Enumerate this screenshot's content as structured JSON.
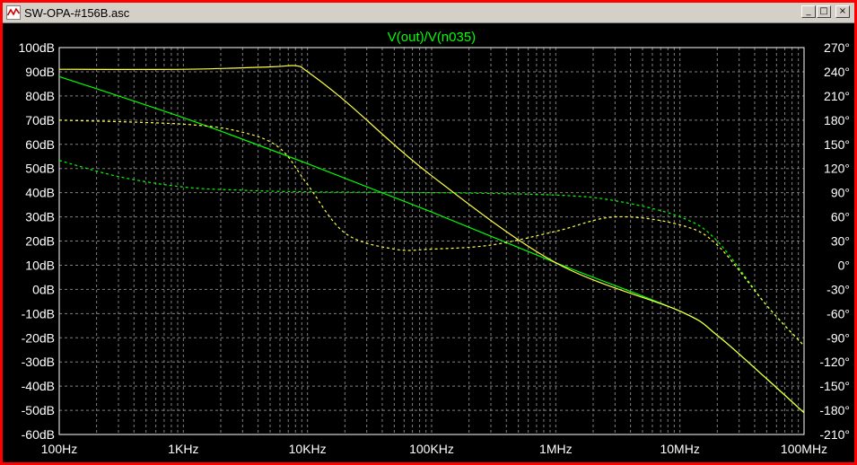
{
  "window": {
    "title": "SW-OPA-#156B.asc",
    "buttons": {
      "minimize": "_",
      "maximize": "□",
      "close": "×"
    }
  },
  "colors": {
    "background": "#000000",
    "grid": "#808080",
    "trace_magnitude": "#00ff00",
    "trace_magnitude_2": "#ffff44",
    "frame": "#ff0000",
    "text": "#ffffff"
  },
  "chart_data": {
    "type": "line",
    "title": "V(out)/V(n035)",
    "x_scale": "log",
    "xlim": [
      100,
      100000000
    ],
    "x_ticks": [
      {
        "value": 100,
        "label": "100Hz"
      },
      {
        "value": 1000,
        "label": "1KHz"
      },
      {
        "value": 10000,
        "label": "10KHz"
      },
      {
        "value": 100000,
        "label": "100KHz"
      },
      {
        "value": 1000000,
        "label": "1MHz"
      },
      {
        "value": 10000000,
        "label": "10MHz"
      },
      {
        "value": 100000000,
        "label": "100MHz"
      }
    ],
    "y_left_range": [
      -60,
      100
    ],
    "y_left_ticks": [
      {
        "value": 100,
        "label": "100dB"
      },
      {
        "value": 90,
        "label": "90dB"
      },
      {
        "value": 80,
        "label": "80dB"
      },
      {
        "value": 70,
        "label": "70dB"
      },
      {
        "value": 60,
        "label": "60dB"
      },
      {
        "value": 50,
        "label": "50dB"
      },
      {
        "value": 40,
        "label": "40dB"
      },
      {
        "value": 30,
        "label": "30dB"
      },
      {
        "value": 20,
        "label": "20dB"
      },
      {
        "value": 10,
        "label": "10dB"
      },
      {
        "value": 0,
        "label": "0dB"
      },
      {
        "value": -10,
        "label": "-10dB"
      },
      {
        "value": -20,
        "label": "-20dB"
      },
      {
        "value": -30,
        "label": "-30dB"
      },
      {
        "value": -40,
        "label": "-40dB"
      },
      {
        "value": -50,
        "label": "-50dB"
      },
      {
        "value": -60,
        "label": "-60dB"
      }
    ],
    "y_right_range": [
      -210,
      270
    ],
    "y_right_ticks": [
      {
        "value": 270,
        "label": "270°"
      },
      {
        "value": 240,
        "label": "240°"
      },
      {
        "value": 210,
        "label": "210°"
      },
      {
        "value": 180,
        "label": "180°"
      },
      {
        "value": 150,
        "label": "150°"
      },
      {
        "value": 120,
        "label": "120°"
      },
      {
        "value": 90,
        "label": "90°"
      },
      {
        "value": 60,
        "label": "60°"
      },
      {
        "value": 30,
        "label": "30°"
      },
      {
        "value": 0,
        "label": "0°"
      },
      {
        "value": -30,
        "label": "-30°"
      },
      {
        "value": -60,
        "label": "-60°"
      },
      {
        "value": -90,
        "label": "-90°"
      },
      {
        "value": -120,
        "label": "-120°"
      },
      {
        "value": -150,
        "label": "-150°"
      },
      {
        "value": -180,
        "label": "-180°"
      },
      {
        "value": -210,
        "label": "-210°"
      }
    ],
    "grid": true,
    "series": [
      {
        "axis": "left",
        "style": "solid",
        "color": "#00ff00",
        "x": [
          100,
          1000,
          10000,
          100000,
          1000000,
          10000000,
          20000000,
          50000000,
          100000000
        ],
        "y": [
          88,
          71,
          52,
          32,
          11,
          -9,
          -19,
          -37,
          -51
        ]
      },
      {
        "axis": "left",
        "style": "solid",
        "color": "#ffff44",
        "x": [
          100,
          1000,
          5000,
          8000,
          10000,
          20000,
          100000,
          1000000,
          10000000,
          20000000,
          50000000,
          100000000
        ],
        "y": [
          91,
          91,
          92,
          92.5,
          90,
          78,
          47,
          11,
          -9,
          -19,
          -37,
          -51
        ]
      },
      {
        "axis": "right",
        "style": "dashed",
        "color": "#00ff00",
        "x": [
          100,
          300,
          1000,
          3000,
          10000,
          100000,
          1000000,
          3000000,
          10000000,
          20000000,
          50000000,
          100000000
        ],
        "y": [
          130,
          110,
          97,
          93,
          91,
          90,
          87,
          80,
          60,
          30,
          -50,
          -100
        ]
      },
      {
        "axis": "right",
        "style": "dashed",
        "color": "#ffff44",
        "x": [
          100,
          1000,
          3000,
          6000,
          10000,
          20000,
          50000,
          100000,
          300000,
          1000000,
          3000000,
          10000000,
          20000000,
          50000000,
          100000000
        ],
        "y": [
          180,
          175,
          165,
          145,
          100,
          40,
          20,
          20,
          25,
          42,
          60,
          50,
          25,
          -50,
          -100
        ]
      }
    ]
  }
}
